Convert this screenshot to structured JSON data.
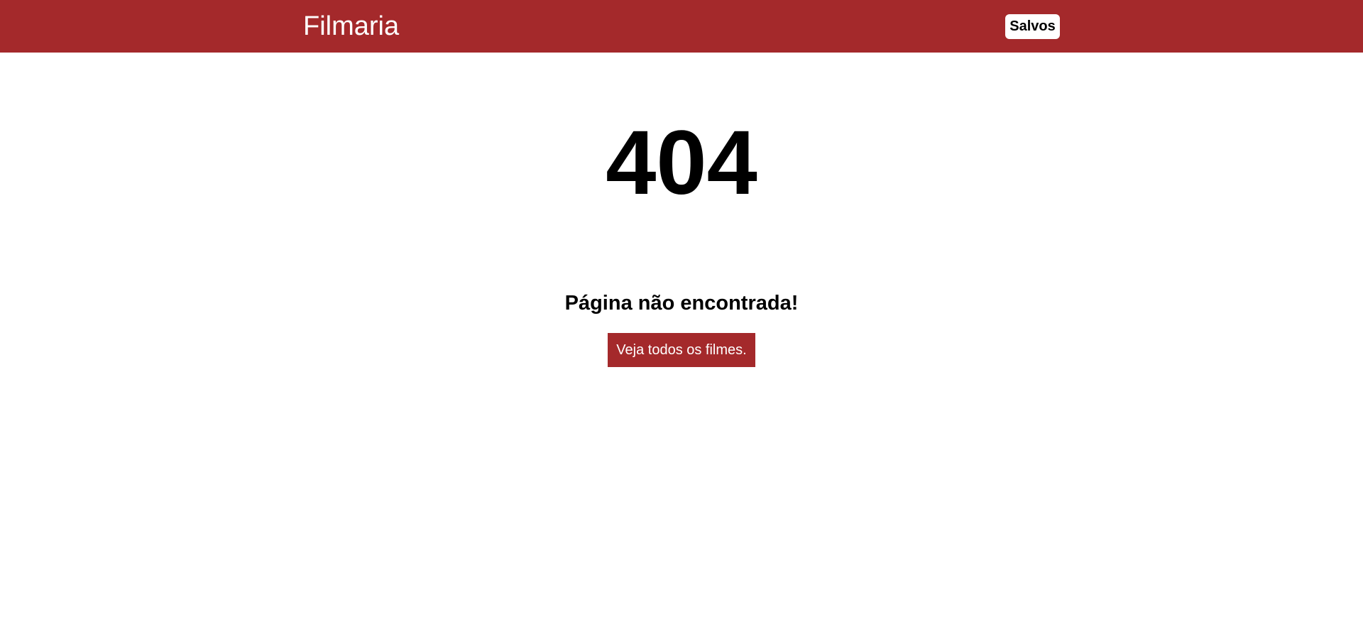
{
  "header": {
    "brand": "Filmaria",
    "saved_label": "Salvos"
  },
  "error": {
    "code": "404",
    "message": "Página não encontrada!",
    "link_label": "Veja todos os filmes."
  },
  "colors": {
    "brand_red": "#a4292b",
    "background": "#ffffff"
  }
}
